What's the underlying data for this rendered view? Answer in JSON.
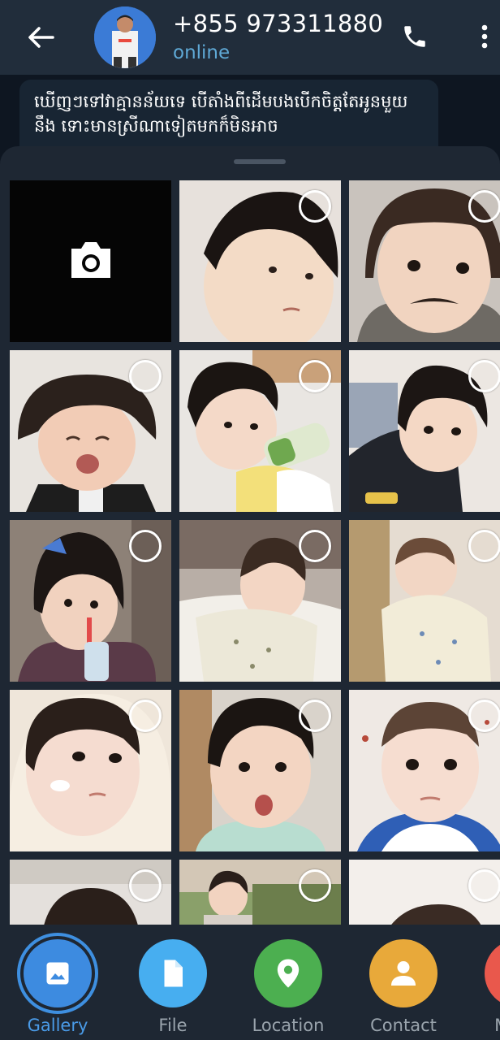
{
  "header": {
    "contact_name": "+855 973311880",
    "status": "online",
    "back_icon": "arrow-back-icon",
    "call_icon": "phone-icon",
    "menu_icon": "more-vertical-icon"
  },
  "message": {
    "text": "ឃើញៗទៅវាគ្មានន័យទេ បើតាំងពីដើមបងបើកចិត្តតែអូនមួយនឹង ទោះមានស្រីណាទៀតមកក៏មិនអាច"
  },
  "gallery": {
    "camera_icon": "camera-icon",
    "photos_count_visible": 14
  },
  "attach_bar": {
    "items": [
      {
        "label": "Gallery",
        "icon": "image-icon",
        "color": "#3d8be0",
        "active": true
      },
      {
        "label": "File",
        "icon": "file-icon",
        "color": "#47aef0",
        "active": false
      },
      {
        "label": "Location",
        "icon": "location-pin-icon",
        "color": "#4caf50",
        "active": false
      },
      {
        "label": "Contact",
        "icon": "person-icon",
        "color": "#e8a93a",
        "active": false
      },
      {
        "label": "Music",
        "icon": "music-icon",
        "color": "#e9584c",
        "active": false
      }
    ]
  },
  "colors": {
    "header_bg": "#212d3b",
    "sheet_bg": "#1e2733",
    "accent": "#4a9be8",
    "status": "#5fa9d6"
  }
}
